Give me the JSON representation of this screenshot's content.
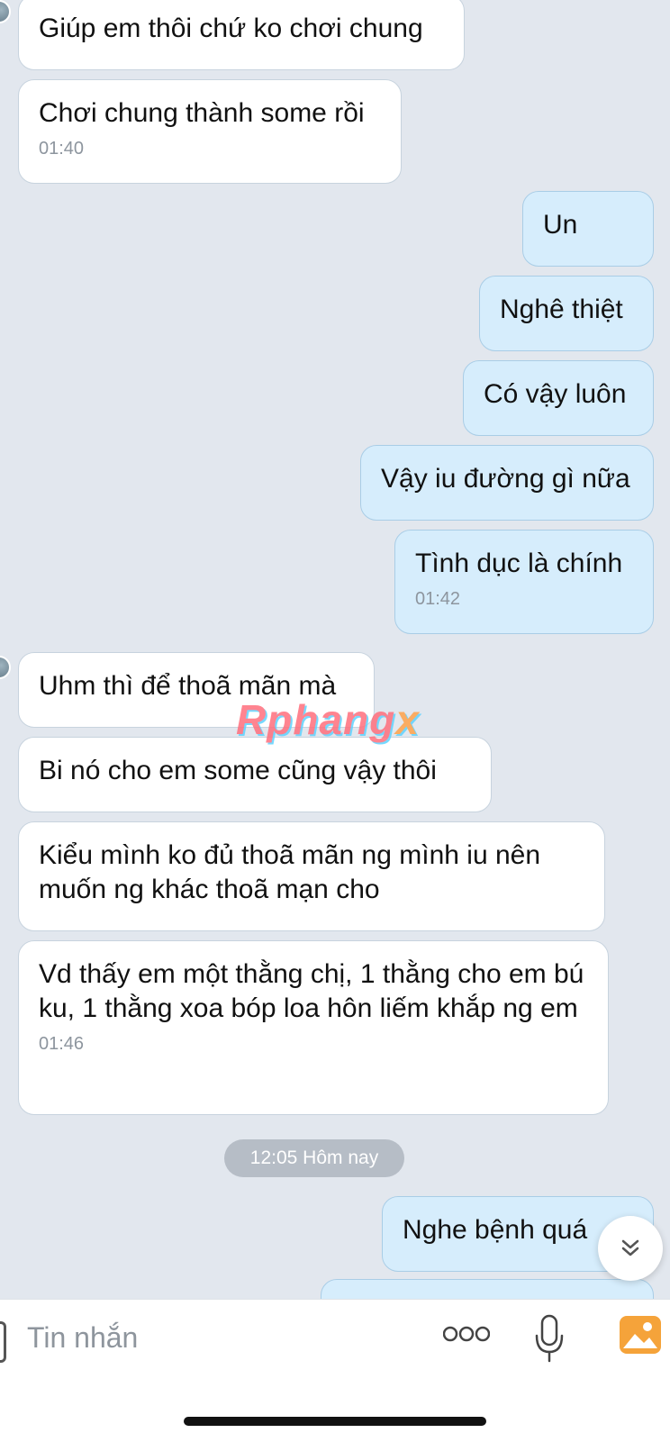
{
  "messages": [
    {
      "dir": "in",
      "text": "Giúp em thôi chứ ko chơi chung",
      "time": ""
    },
    {
      "dir": "in",
      "text": "Chơi chung thành some rồi",
      "time": "01:40"
    },
    {
      "dir": "out",
      "text": "Un",
      "time": ""
    },
    {
      "dir": "out",
      "text": "Nghê thiệt",
      "time": ""
    },
    {
      "dir": "out",
      "text": "Có vậy luôn",
      "time": ""
    },
    {
      "dir": "out",
      "text": "Vậy iu đường gì nữa",
      "time": ""
    },
    {
      "dir": "out",
      "text": "Tình dục là chính",
      "time": "01:42"
    },
    {
      "dir": "in",
      "text": "Uhm thì để thoã mãn mà",
      "time": ""
    },
    {
      "dir": "in",
      "text": "Bi nó cho em some cũng vậy thôi",
      "time": ""
    },
    {
      "dir": "in",
      "text": "Kiểu mình ko đủ thoã mãn ng mình iu nên muốn ng khác thoã mạn cho",
      "time": ""
    },
    {
      "dir": "in",
      "text": "Vd thấy em một thằng chị, 1 thằng cho em bú ku, 1 thằng xoa bóp loa hôn liếm khắp ng em",
      "time": "01:46"
    },
    {
      "dir": "out",
      "text": "Nghe bệnh quá",
      "time": ""
    }
  ],
  "divider": {
    "label": "12:05 Hôm nay"
  },
  "watermark": {
    "main": "Rphang",
    "tail": "x"
  },
  "composer": {
    "placeholder": "Tin nhắn"
  },
  "icons": {
    "scroll_down": "chevron-double-down-icon",
    "more": "more-dots-icon",
    "mic": "microphone-icon",
    "photo": "photo-icon"
  },
  "colors": {
    "incoming": "#ffffff",
    "outgoing": "#d6edfc",
    "background": "#e2e7ee",
    "photo_icon": "#f5a33a"
  }
}
